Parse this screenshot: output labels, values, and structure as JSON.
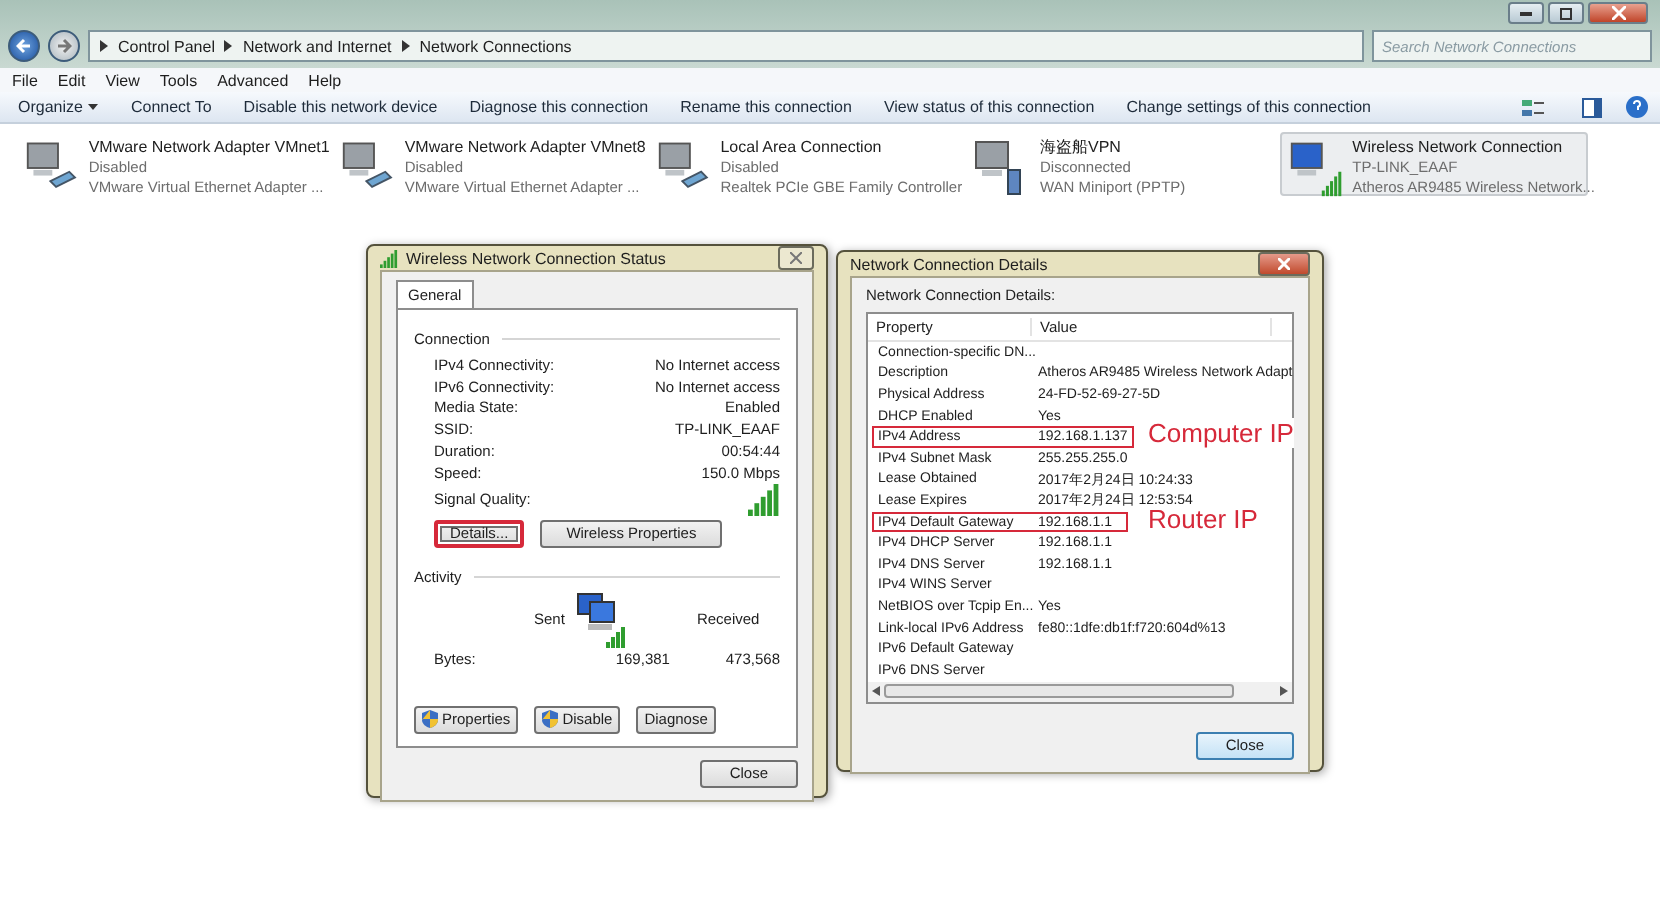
{
  "address_bar": {
    "crumbs": [
      "Control Panel",
      "Network and Internet",
      "Network Connections"
    ],
    "search_placeholder": "Search Network Connections"
  },
  "menu": [
    "File",
    "Edit",
    "View",
    "Tools",
    "Advanced",
    "Help"
  ],
  "toolbar": [
    {
      "label": "Organize",
      "dropdown": true
    },
    {
      "label": "Connect To",
      "dropdown": false
    },
    {
      "label": "Disable this network device",
      "dropdown": false
    },
    {
      "label": "Diagnose this connection",
      "dropdown": false
    },
    {
      "label": "Rename this connection",
      "dropdown": false
    },
    {
      "label": "View status of this connection",
      "dropdown": false
    },
    {
      "label": "Change settings of this connection",
      "dropdown": false
    }
  ],
  "adapters": [
    {
      "name": "VMware Network Adapter VMnet1",
      "status": "Disabled",
      "device": "VMware Virtual Ethernet Adapter ...",
      "kind": "wired",
      "selected": false
    },
    {
      "name": "VMware Network Adapter VMnet8",
      "status": "Disabled",
      "device": "VMware Virtual Ethernet Adapter ...",
      "kind": "wired",
      "selected": false
    },
    {
      "name": "Local Area Connection",
      "status": "Disabled",
      "device": "Realtek PCIe GBE Family Controller",
      "kind": "wired",
      "selected": false
    },
    {
      "name": "海盗船VPN",
      "status": "Disconnected",
      "device": "WAN Miniport (PPTP)",
      "kind": "vpn",
      "selected": false
    },
    {
      "name": "Wireless Network Connection",
      "status": "TP-LINK_EAAF",
      "device": "Atheros AR9485 Wireless Network...",
      "kind": "wireless",
      "selected": true
    }
  ],
  "status_dialog": {
    "title": "Wireless Network Connection Status",
    "tab": "General",
    "connection_heading": "Connection",
    "connection": [
      {
        "label": "IPv4 Connectivity:",
        "value": "No Internet access"
      },
      {
        "label": "IPv6 Connectivity:",
        "value": "No Internet access"
      },
      {
        "label": "Media State:",
        "value": "Enabled"
      },
      {
        "label": "SSID:",
        "value": "TP-LINK_EAAF"
      },
      {
        "label": "Duration:",
        "value": "00:54:44"
      },
      {
        "label": "Speed:",
        "value": "150.0 Mbps"
      }
    ],
    "signal_label": "Signal Quality:",
    "buttons": [
      {
        "label": "Details...",
        "highlighted": true
      },
      {
        "label": "Wireless Properties",
        "highlighted": false
      }
    ],
    "activity_heading": "Activity",
    "sent": "Sent",
    "received": "Received",
    "bytes_label": "Bytes:",
    "bytes_sent": "169,381",
    "bytes_received": "473,568",
    "action_buttons": [
      {
        "label": "Properties",
        "shield": true
      },
      {
        "label": "Disable",
        "shield": true
      },
      {
        "label": "Diagnose",
        "shield": false
      }
    ],
    "close": "Close"
  },
  "details_dialog": {
    "title": "Network Connection Details",
    "caption": "Network Connection Details:",
    "columns": [
      "Property",
      "Value"
    ],
    "rows": [
      {
        "property": "Connection-specific DN...",
        "value": "",
        "highlighted": false
      },
      {
        "property": "Description",
        "value": "Atheros AR9485 Wireless Network Adapt",
        "highlighted": false
      },
      {
        "property": "Physical Address",
        "value": "24-FD-52-69-27-5D",
        "highlighted": false
      },
      {
        "property": "DHCP Enabled",
        "value": "Yes",
        "highlighted": false
      },
      {
        "property": "IPv4 Address",
        "value": "192.168.1.137",
        "highlighted": true,
        "note": "Computer IP"
      },
      {
        "property": "IPv4 Subnet Mask",
        "value": "255.255.255.0",
        "highlighted": false
      },
      {
        "property": "Lease Obtained",
        "value": "2017年2月24日 10:24:33",
        "highlighted": false
      },
      {
        "property": "Lease Expires",
        "value": "2017年2月24日 12:53:54",
        "highlighted": false
      },
      {
        "property": "IPv4 Default Gateway",
        "value": "192.168.1.1",
        "highlighted": true,
        "note": "Router IP"
      },
      {
        "property": "IPv4 DHCP Server",
        "value": "192.168.1.1",
        "highlighted": false
      },
      {
        "property": "IPv4 DNS Server",
        "value": "192.168.1.1",
        "highlighted": false
      },
      {
        "property": "IPv4 WINS Server",
        "value": "",
        "highlighted": false
      },
      {
        "property": "NetBIOS over Tcpip En...",
        "value": "Yes",
        "highlighted": false
      },
      {
        "property": "Link-local IPv6 Address",
        "value": "fe80::1dfe:db1f:f720:604d%13",
        "highlighted": false
      },
      {
        "property": "IPv6 Default Gateway",
        "value": "",
        "highlighted": false
      },
      {
        "property": "IPv6 DNS Server",
        "value": "",
        "highlighted": false
      }
    ],
    "close": "Close"
  }
}
